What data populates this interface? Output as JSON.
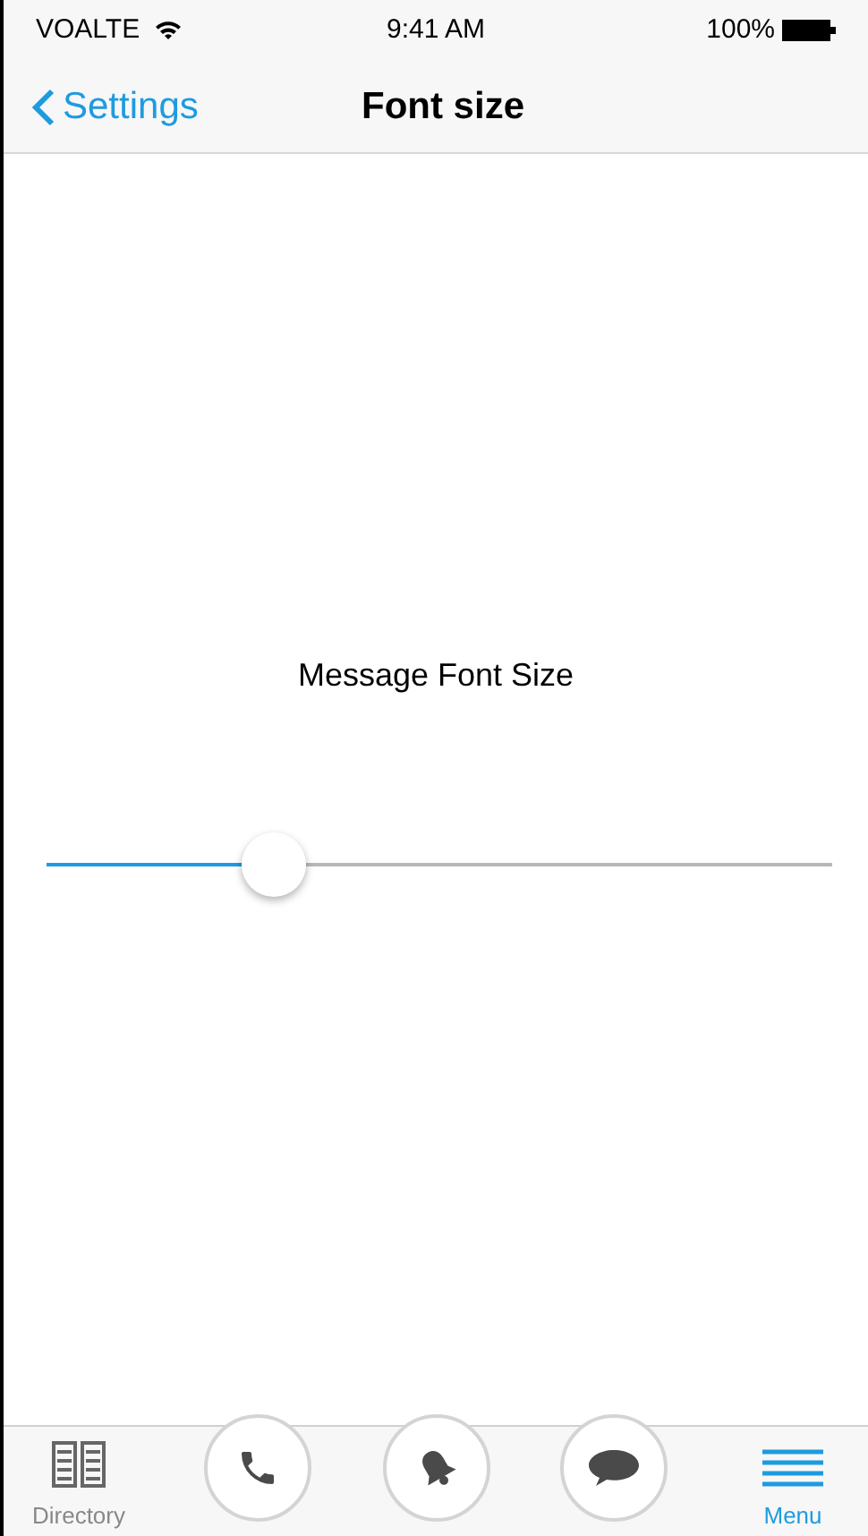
{
  "status_bar": {
    "carrier": "VOALTE",
    "time": "9:41 AM",
    "battery": "100%"
  },
  "nav_bar": {
    "back": "Settings",
    "title": "Font size"
  },
  "setting": {
    "label": "Message Font Size",
    "level": 0.29
  },
  "tab_bar": [
    {
      "kind": "tab",
      "label": "Directory",
      "selected": false
    },
    {
      "kind": "round"
    },
    {
      "kind": "round"
    },
    {
      "kind": "round"
    },
    {
      "kind": "tab",
      "label": "Menu",
      "selected": true
    }
  ]
}
